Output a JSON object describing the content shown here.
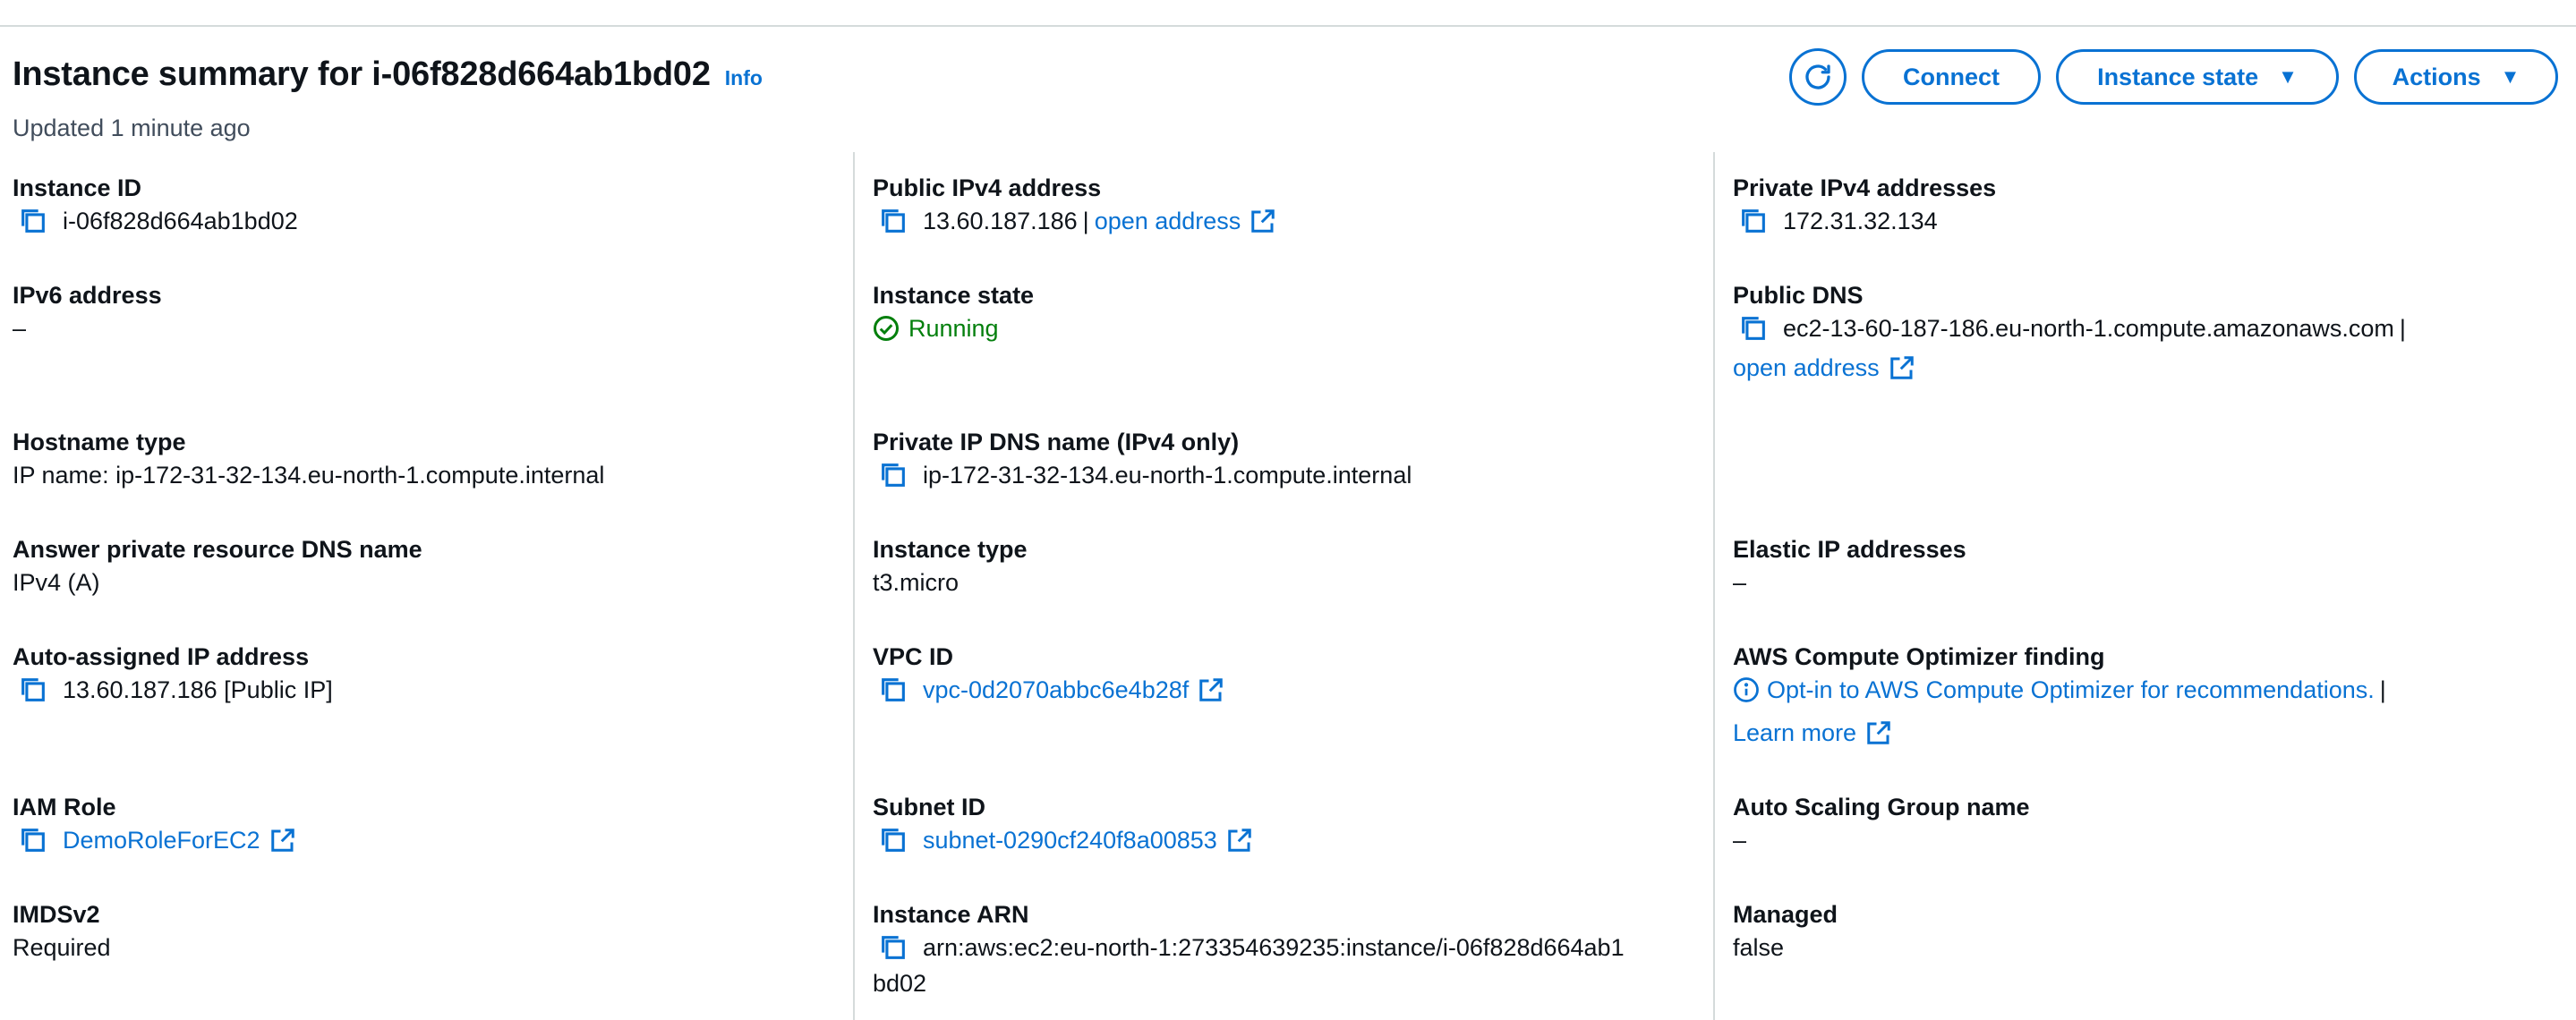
{
  "header": {
    "title": "Instance summary for i-06f828d664ab1bd02",
    "info_label": "Info",
    "updated": "Updated 1 minute ago",
    "buttons": {
      "connect": "Connect",
      "instance_state": "Instance state",
      "actions": "Actions"
    }
  },
  "col1": {
    "instance_id": {
      "label": "Instance ID",
      "value": "i-06f828d664ab1bd02"
    },
    "ipv6": {
      "label": "IPv6 address",
      "value": "–"
    },
    "hostname_type": {
      "label": "Hostname type",
      "value": "IP name: ip-172-31-32-134.eu-north-1.compute.internal"
    },
    "answer_dns": {
      "label": "Answer private resource DNS name",
      "value": "IPv4 (A)"
    },
    "auto_ip": {
      "label": "Auto-assigned IP address",
      "value": "13.60.187.186 [Public IP]"
    },
    "iam_role": {
      "label": "IAM Role",
      "value": "DemoRoleForEC2"
    },
    "imdsv2": {
      "label": "IMDSv2",
      "value": "Required"
    }
  },
  "col2": {
    "public_ipv4": {
      "label": "Public IPv4 address",
      "value": "13.60.187.186",
      "separator": "|",
      "link": "open address"
    },
    "instance_state": {
      "label": "Instance state",
      "value": "Running"
    },
    "private_dns": {
      "label": "Private IP DNS name (IPv4 only)",
      "value": "ip-172-31-32-134.eu-north-1.compute.internal"
    },
    "instance_type": {
      "label": "Instance type",
      "value": "t3.micro"
    },
    "vpc_id": {
      "label": "VPC ID",
      "value": "vpc-0d2070abbc6e4b28f"
    },
    "subnet_id": {
      "label": "Subnet ID",
      "value": "subnet-0290cf240f8a00853"
    },
    "instance_arn": {
      "label": "Instance ARN",
      "value_line1": "arn:aws:ec2:eu-north-1:273354639235:instance/i-06f828d664ab1",
      "value_line2": "bd02"
    }
  },
  "col3": {
    "private_ipv4": {
      "label": "Private IPv4 addresses",
      "value": "172.31.32.134"
    },
    "public_dns": {
      "label": "Public DNS",
      "value": "ec2-13-60-187-186.eu-north-1.compute.amazonaws.com",
      "separator": "|",
      "link": "open address"
    },
    "elastic_ip": {
      "label": "Elastic IP addresses",
      "value": "–"
    },
    "optimizer": {
      "label": "AWS Compute Optimizer finding",
      "link": "Opt-in to AWS Compute Optimizer for recommendations.",
      "separator": "|",
      "learn_more": "Learn more"
    },
    "asg": {
      "label": "Auto Scaling Group name",
      "value": "–"
    },
    "managed": {
      "label": "Managed",
      "value": "false"
    }
  },
  "colors": {
    "link": "#0972d3",
    "success": "#037f0c",
    "text": "#0f141a",
    "divider": "#d5dbdb"
  },
  "icons": [
    "refresh-icon",
    "copy-icon",
    "external-link-icon",
    "success-check-icon",
    "info-icon",
    "caret-down-icon"
  ]
}
